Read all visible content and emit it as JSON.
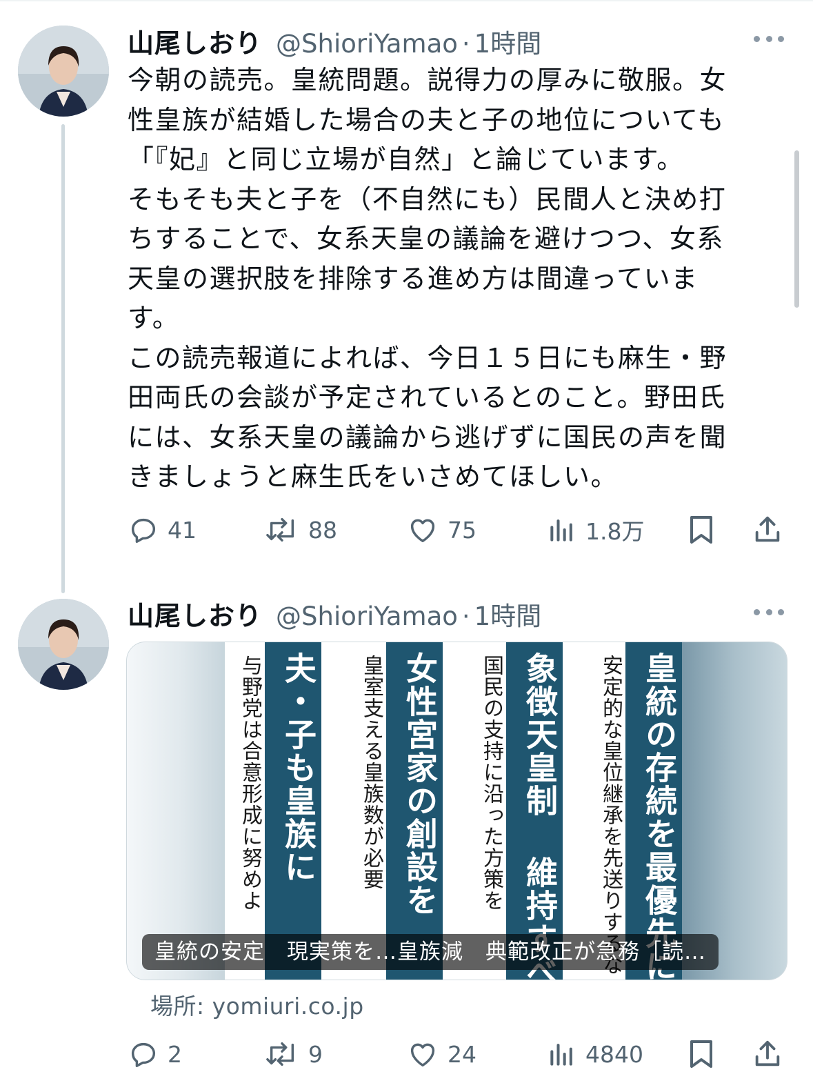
{
  "tweets": [
    {
      "author": {
        "name": "山尾しおり",
        "handle": "@ShioriYamao",
        "separator": "·",
        "time": "1時間"
      },
      "text": "今朝の読売。皇統問題。説得力の厚みに敬服。女\n性皇族が結婚した場合の夫と子の地位についても\n「『妃』と同じ立場が自然」と論じています。\nそもそも夫と子を（不自然にも）民間人と決め打\nちすることで、女系天皇の議論を避けつつ、女系\n天皇の選択肢を排除する進め方は間違っていま\nす。\nこの読売報道によれば、今日１５日にも麻生・野\n田両氏の会談が予定されているとのこと。野田氏\nには、女系天皇の議論から逃げずに国民の声を聞\nきましょうと麻生氏をいさめてほしい。",
      "actions": {
        "replies": "41",
        "retweets": "88",
        "likes": "75",
        "views": "1.8万"
      }
    },
    {
      "author": {
        "name": "山尾しおり",
        "handle": "@ShioriYamao",
        "separator": "·",
        "time": "1時間"
      },
      "card": {
        "columns": [
          "与野党は合意形成に努めよ",
          "夫・子も皇族に",
          "皇室支える皇族数が必要",
          "女性宮家の創設を",
          "国民の支持に沿った方策を",
          "象徴天皇制 維持すべき",
          "安定的な皇位継承を先送りするな",
          "皇統の存続を最優先に"
        ],
        "caption": "皇統の安定　現実策を…皇族減　典範改正が急務［読…",
        "source": "場所: yomiuri.co.jp"
      },
      "actions": {
        "replies": "2",
        "retweets": "9",
        "likes": "24",
        "views": "4840"
      }
    }
  ],
  "colors": {
    "text": "#0f1419",
    "secondary": "#536471",
    "newspaper_accent": "#1f5670"
  },
  "icons": [
    "reply-icon",
    "retweet-icon",
    "like-icon",
    "views-icon",
    "bookmark-icon",
    "share-icon",
    "more-icon"
  ]
}
